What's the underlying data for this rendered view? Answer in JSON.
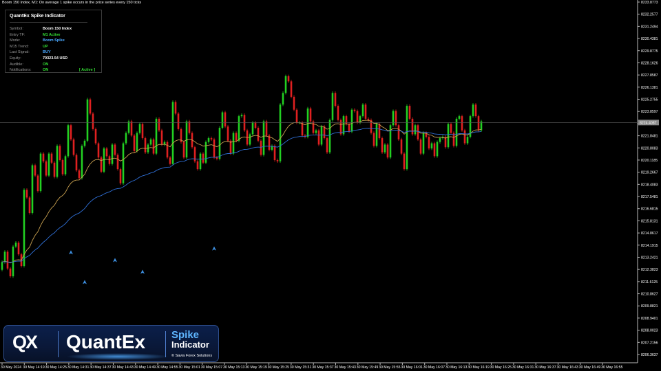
{
  "window": {
    "caption": "Boom 150 Index, M1: On average 1 spike occurs in the price series every 150 ticks"
  },
  "panel": {
    "title": "QuantEx Spike Indicator",
    "rows": [
      {
        "key": "Symbol:",
        "value": "Boom 150 Index",
        "color": "#ffffff"
      },
      {
        "key": "Entry TF:",
        "value": "M1 Active",
        "color": "#34e034"
      },
      {
        "key": "Mode:",
        "value": "Boom Spike",
        "color": "#4aa8ff"
      },
      {
        "key": "M15 Trend:",
        "value": "UP",
        "color": "#34e034"
      },
      {
        "key": "Last Signal:",
        "value": "BUY",
        "color": "#4aa8ff"
      },
      {
        "key": "Equity:",
        "value": "70323.54 USD",
        "color": "#ffffff"
      },
      {
        "key": "Audible:",
        "value": "ON",
        "color": "#34e034"
      },
      {
        "key": "Notifications:",
        "value": "ON",
        "color": "#34e034",
        "extra": "[ Active ]"
      }
    ]
  },
  "logo": {
    "mark": "QX",
    "brand": "QuantEx",
    "product_line1": "Spike",
    "product_line2": "Indicator",
    "credit": "© Savia Forex Solutions"
  },
  "chart_data": {
    "type": "candlestick",
    "y_range": [
      8205.8,
      8233.9
    ],
    "price_labels": [
      "8233.8773",
      "8232.2577",
      "8231.2494",
      "8230.4381",
      "8229.8775",
      "8228.1626",
      "8227.8587",
      "8226.1381",
      "8225.2755",
      "8223.8597",
      "8222.8595",
      "8221.8481",
      "8220.8083",
      "8220.1185",
      "8219.2667",
      "8218.4083",
      "8217.5481",
      "8216.6815",
      "8215.8131",
      "8214.8617",
      "8214.1915",
      "8213.2421",
      "8212.3823",
      "8211.6125",
      "8210.8627",
      "8209.8821",
      "8208.9401",
      "8208.0023",
      "8207.2156",
      "8206.3637"
    ],
    "current_price": "8224.4087",
    "time_labels": [
      "30 May 2024",
      "30 May 14:19",
      "30 May 14:25",
      "30 May 14:31",
      "30 May 14:37",
      "30 May 14:43",
      "30 May 14:49",
      "30 May 14:55",
      "30 May 15:01",
      "30 May 15:07",
      "30 May 15:13",
      "30 May 15:19",
      "30 May 15:25",
      "30 May 15:31",
      "30 May 15:37",
      "30 May 15:43",
      "30 May 15:49",
      "30 May 15:55",
      "30 May 16:01",
      "30 May 16:07",
      "30 May 16:13",
      "30 May 16:19",
      "30 May 16:25",
      "30 May 16:31",
      "30 May 16:37",
      "30 May 16:43",
      "30 May 16:49",
      "30 May 16:55"
    ],
    "closes": [
      8213.6,
      8214.4,
      8213.1,
      8212.5,
      8214.8,
      8215.1,
      8214.2,
      8213.3,
      8219.2,
      8218.6,
      8217.4,
      8221.1,
      8220.3,
      8219.1,
      8222.0,
      8221.4,
      8220.3,
      8222.0,
      8221.3,
      8220.2,
      8222.6,
      8221.5,
      8220.4,
      8221.8,
      8224.2,
      8223.1,
      8221.9,
      8220.7,
      8220.1,
      8222.6,
      8223.0,
      8226.2,
      8225.1,
      8223.9,
      8222.8,
      8221.7,
      8220.6,
      8222.4,
      8221.8,
      8221.2,
      8222.7,
      8221.9,
      8220.8,
      8219.7,
      8222.8,
      8223.6,
      8224.5,
      8223.4,
      8222.2,
      8223.6,
      8224.3,
      8223.2,
      8222.1,
      8222.7,
      8223.1,
      8222.0,
      8224.7,
      8223.8,
      8222.7,
      8222.9,
      8221.7,
      8221.2,
      8226.0,
      8225.1,
      8223.9,
      8222.9,
      8221.7,
      8224.5,
      8223.6,
      8222.5,
      8221.4,
      8220.8,
      8222.0,
      8221.3,
      8222.9,
      8223.2,
      8223.1,
      8221.7,
      8221.6,
      8224.0,
      8225.2,
      8224.1,
      8223.0,
      8222.0,
      8223.6,
      8223.0,
      8224.9,
      8225.0,
      8223.8,
      8222.7,
      8223.5,
      8224.4,
      8224.0,
      8223.0,
      8221.9,
      8224.5,
      8223.4,
      8222.3,
      8222.6,
      8221.5,
      8221.4,
      8225.8,
      8226.7,
      8228.0,
      8227.6,
      8226.4,
      8225.4,
      8224.4,
      8224.4,
      8223.4,
      8223.3,
      8225.5,
      8224.5,
      8223.6,
      8223.8,
      8222.7,
      8224.1,
      8223.2,
      8222.1,
      8224.6,
      8226.7,
      8225.7,
      8224.6,
      8223.5,
      8224.9,
      8224.3,
      8223.7,
      8225.4,
      8225.3,
      8224.4,
      8224.9,
      8225.8,
      8224.7,
      8224.6,
      8223.6,
      8222.6,
      8224.3,
      8223.2,
      8222.1,
      8222.7,
      8221.7,
      8224.2,
      8225.3,
      8224.2,
      8223.1,
      8222.0,
      8220.8,
      8225.7,
      8224.7,
      8223.5,
      8224.2,
      8223.1,
      8222.0,
      8223.6,
      8223.3,
      8222.4,
      8222.8,
      8221.8,
      8222.9,
      8223.2,
      8223.3,
      8222.5,
      8224.3,
      8223.6,
      8222.6,
      8224.7,
      8224.9,
      8223.8,
      8222.8,
      8223.3,
      8224.9,
      8225.8,
      8224.9,
      8223.8,
      8224.5
    ],
    "buy_arrows": [
      {
        "bar": 25,
        "price": 8214.3
      },
      {
        "bar": 30,
        "price": 8212.0
      },
      {
        "bar": 41,
        "price": 8213.7
      },
      {
        "bar": 51,
        "price": 8212.8
      },
      {
        "bar": 77,
        "price": 8214.6
      }
    ],
    "colors": {
      "bull": "#22d022",
      "bear": "#e02020",
      "ma_fast": "#c8a050",
      "ma_slow": "#2f6fd6",
      "grid": "#555555",
      "arrow": "#3d8fe0"
    }
  }
}
